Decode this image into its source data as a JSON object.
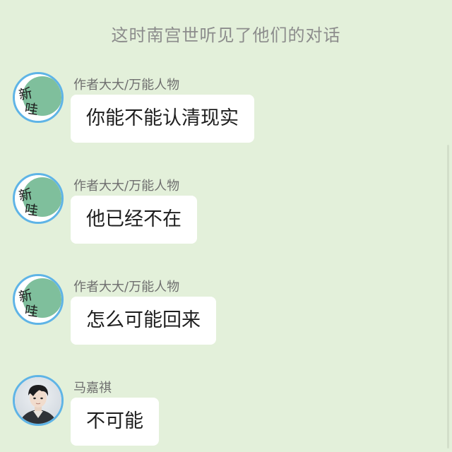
{
  "narration": "这时南宫世听见了他们的对话",
  "messages": [
    {
      "sender": "作者大大/万能人物",
      "text": "你能不能认清现实",
      "avatar": "green-logo-avatar"
    },
    {
      "sender": "作者大大/万能人物",
      "text": "他已经不在",
      "avatar": "green-logo-avatar"
    },
    {
      "sender": "作者大大/万能人物",
      "text": "怎么可能回来",
      "avatar": "green-logo-avatar"
    },
    {
      "sender": "马嘉祺",
      "text": "不可能",
      "avatar": "photo-avatar"
    }
  ],
  "avatar_logo_text": "新哇",
  "colors": {
    "background": "#e3f0da",
    "bubble": "#ffffff",
    "avatar_ring": "#5fb4e6",
    "avatar_green": "#7fbf9c",
    "narration_text": "#8c8c8c",
    "sender_text": "#6f6f6f",
    "message_text": "#1e1e1e"
  }
}
